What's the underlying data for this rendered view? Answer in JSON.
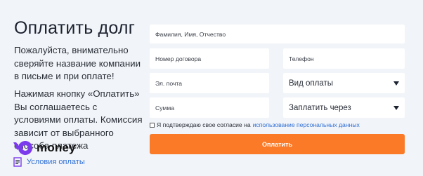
{
  "heading": "Оплатить долг",
  "intro_text": "Пожалуйста, внимательно сверяйте название компании в письме и при оплате!",
  "agreement_text": "Нажимая кнопку «Оплатить» Вы соглашаетесь с условиями оплаты. Комиссия зависит от выбранного способа платежа",
  "brand": {
    "name": "money",
    "icon": "yoomoney-logo",
    "color": "#7c3aed"
  },
  "terms_link": {
    "label": "Условия оплаты",
    "icon": "document-icon"
  },
  "form": {
    "full_name": {
      "placeholder": "Фамилия, Имя, Отчество"
    },
    "contract_number": {
      "placeholder": "Номер договора"
    },
    "phone": {
      "placeholder": "Телефон"
    },
    "email": {
      "placeholder": "Эл. почта"
    },
    "amount": {
      "placeholder": "Сумма"
    },
    "payment_type": {
      "value": "Вид оплаты"
    },
    "pay_via": {
      "value": "Заплатить через"
    },
    "consent": {
      "text": "Я подтверждаю свое согласие на",
      "link": "использование персональных данных"
    },
    "submit_label": "Оплатить"
  },
  "colors": {
    "accent": "#fa7a28",
    "link": "#2f6fd6",
    "background": "#f1f4f8"
  }
}
